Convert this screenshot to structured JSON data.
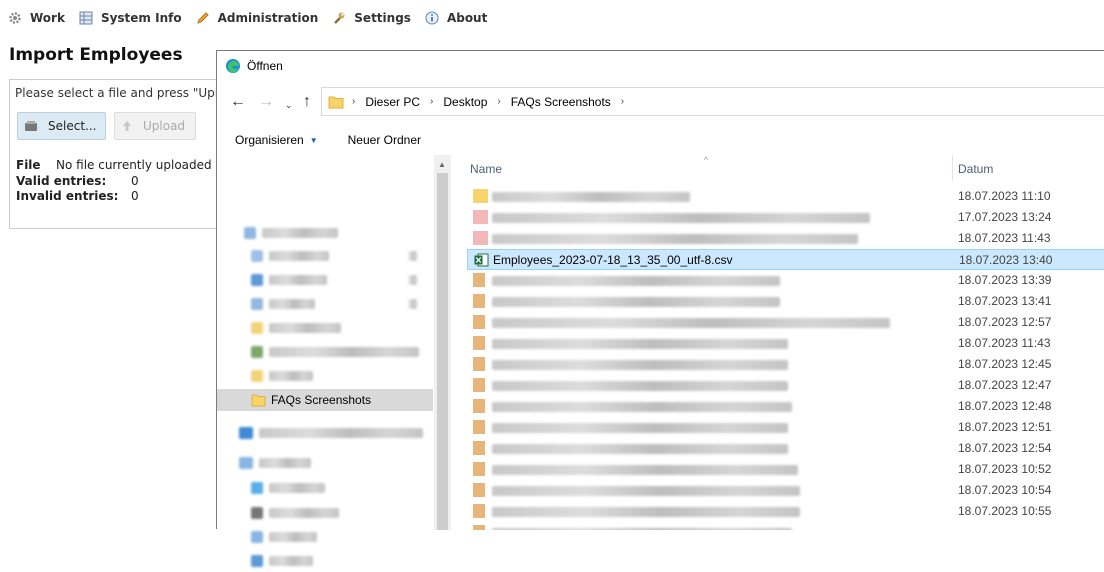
{
  "nav": {
    "work": "Work",
    "system_info": "System Info",
    "administration": "Administration",
    "settings": "Settings",
    "about": "About"
  },
  "page": {
    "title": "Import Employees",
    "hint": "Please select a file and press \"Uploa",
    "select_label": "Select...",
    "upload_label": "Upload",
    "file_label": "File",
    "file_value": "No file currently uploaded",
    "valid_label": "Valid entries:",
    "valid_value": "0",
    "invalid_label": "Invalid entries:",
    "invalid_value": "0"
  },
  "dialog": {
    "title": "Öffnen",
    "breadcrumb": [
      "Dieser PC",
      "Desktop",
      "FAQs Screenshots"
    ],
    "organize": "Organisieren",
    "new_folder": "Neuer Ordner",
    "selected_folder": "FAQs Screenshots",
    "col_name": "Name",
    "col_date": "Datum",
    "selected_file": "Employees_2023-07-18_13_35_00_utf-8.csv",
    "dates": [
      "18.07.2023 11:10",
      "17.07.2023 13:24",
      "18.07.2023 11:43",
      "18.07.2023 13:40",
      "18.07.2023 13:39",
      "18.07.2023 13:41",
      "18.07.2023 12:57",
      "18.07.2023 11:43",
      "18.07.2023 12:45",
      "18.07.2023 12:47",
      "18.07.2023 12:48",
      "18.07.2023 12:51",
      "18.07.2023 12:54",
      "18.07.2023 10:52",
      "18.07.2023 10:54",
      "18.07.2023 10:55"
    ]
  },
  "colors": {
    "selection": "#cce8ff",
    "select_button": "#dceaf4"
  }
}
